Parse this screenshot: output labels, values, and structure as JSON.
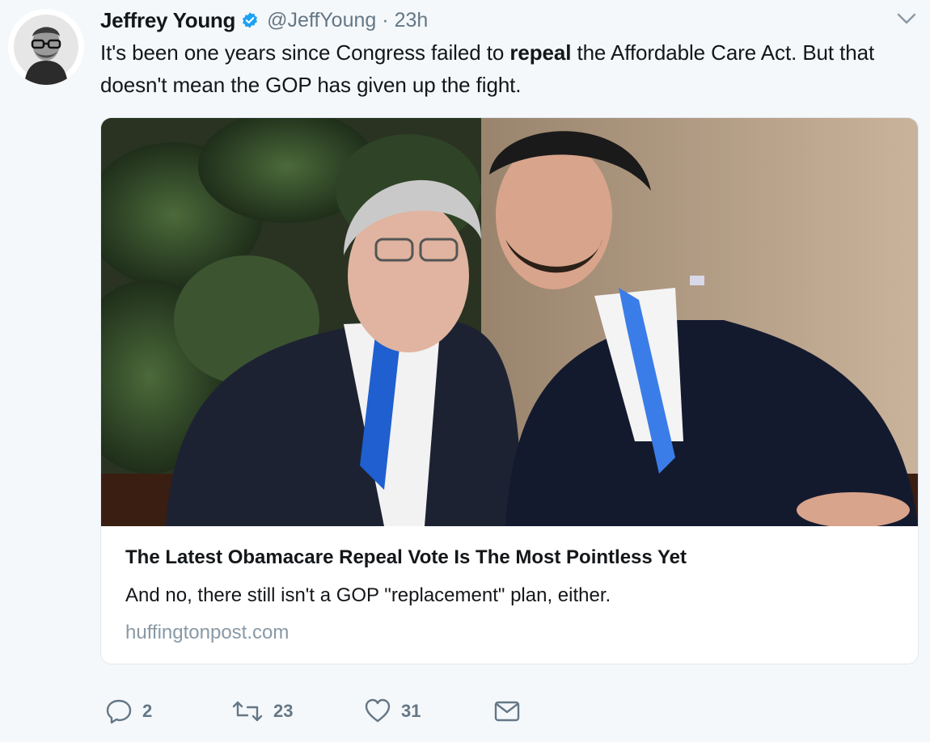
{
  "author": {
    "display_name": "Jeffrey Young",
    "handle": "@JeffYoung",
    "separator": "·",
    "timestamp": "23h",
    "verified": true,
    "avatar_icon": "avatar-portrait"
  },
  "tweet": {
    "text_before": "It's been one years since Congress failed to ",
    "text_bold": "repeal",
    "text_after": " the Affordable Care Act. But that doesn't mean the GOP has given up the fight."
  },
  "card": {
    "image_icon": "article-photo",
    "title": "The Latest Obamacare Repeal Vote Is The Most Pointless Yet",
    "description": "And no, there still isn't a GOP \"replacement\" plan, either.",
    "domain": "huffingtonpost.com"
  },
  "actions": {
    "reply_count": "2",
    "retweet_count": "23",
    "like_count": "31"
  },
  "colors": {
    "background": "#f5f8fa",
    "text": "#14171a",
    "secondary_text": "#657786",
    "verified_blue": "#1da1f2",
    "border": "#e1e8ed"
  }
}
